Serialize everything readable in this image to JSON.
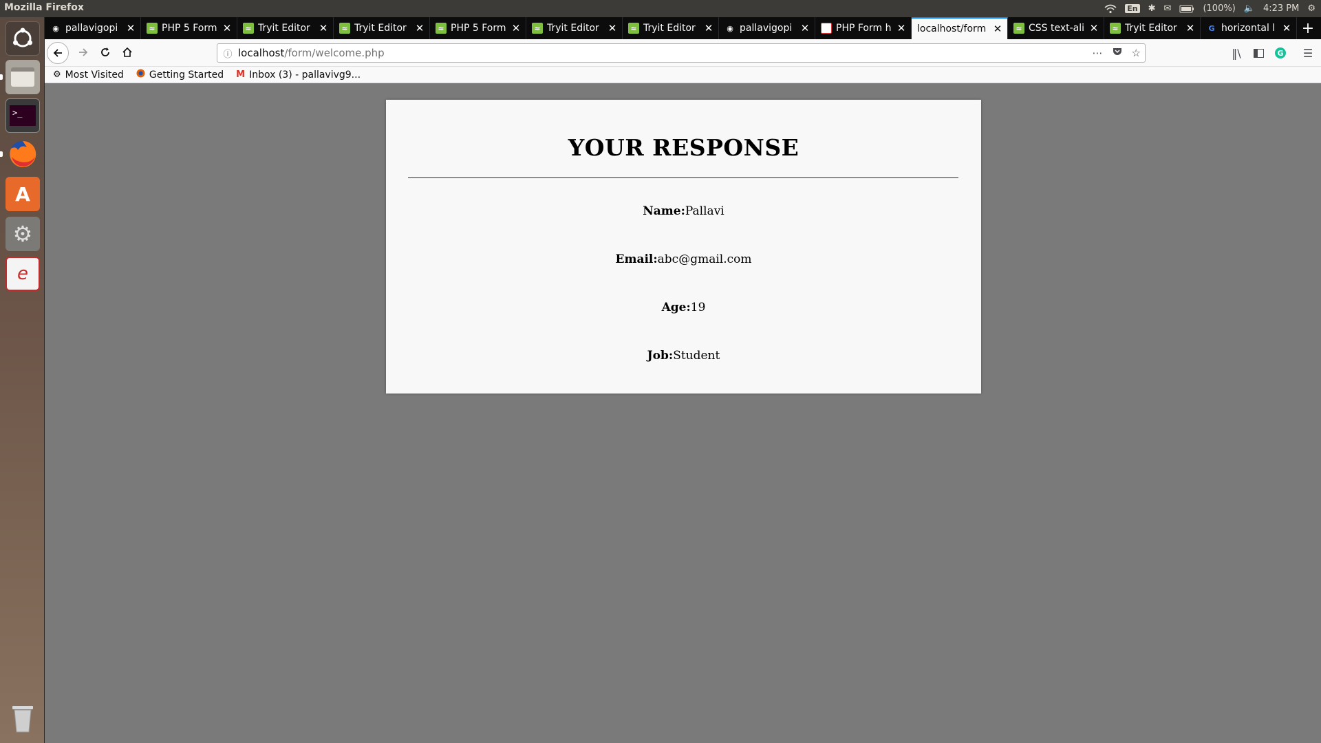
{
  "system": {
    "window_title": "Mozilla Firefox",
    "keyboard": "En",
    "battery": "(100%)",
    "time": "4:23 PM"
  },
  "browser": {
    "tabs": [
      {
        "label": "pallavigopi",
        "favicon": "github-icon",
        "active": false
      },
      {
        "label": "PHP 5 Form",
        "favicon": "tryit-icon",
        "active": false
      },
      {
        "label": "Tryit Editor",
        "favicon": "tryit-icon",
        "active": false
      },
      {
        "label": "Tryit Editor",
        "favicon": "tryit-icon",
        "active": false
      },
      {
        "label": "PHP 5 Form",
        "favicon": "tryit-icon",
        "active": false
      },
      {
        "label": "Tryit Editor",
        "favicon": "tryit-icon",
        "active": false
      },
      {
        "label": "Tryit Editor",
        "favicon": "tryit-icon",
        "active": false
      },
      {
        "label": "pallavigopi",
        "favicon": "github-icon",
        "active": false
      },
      {
        "label": "PHP Form h",
        "favicon": "pdf-icon",
        "active": false
      },
      {
        "label": "localhost/form",
        "favicon": "none",
        "active": true
      },
      {
        "label": "CSS text-ali",
        "favicon": "tryit-icon",
        "active": false
      },
      {
        "label": "Tryit Editor",
        "favicon": "tryit-icon",
        "active": false
      },
      {
        "label": "horizontal l",
        "favicon": "google-icon",
        "active": false
      }
    ],
    "url": {
      "host": "localhost",
      "path": "/form/welcome.php"
    },
    "bookmarks": [
      {
        "label": "Most Visited",
        "icon": "gear-icon"
      },
      {
        "label": "Getting Started",
        "icon": "firefox-icon"
      },
      {
        "label": "Inbox (3) - pallavivg9...",
        "icon": "gmail-icon"
      }
    ]
  },
  "page": {
    "heading": "YOUR RESPONSE",
    "fields": [
      {
        "label": "Name:",
        "value": "Pallavi"
      },
      {
        "label": "Email:",
        "value": "abc@gmail.com"
      },
      {
        "label": "Age:",
        "value": "19"
      },
      {
        "label": "Job:",
        "value": "Student"
      }
    ]
  }
}
